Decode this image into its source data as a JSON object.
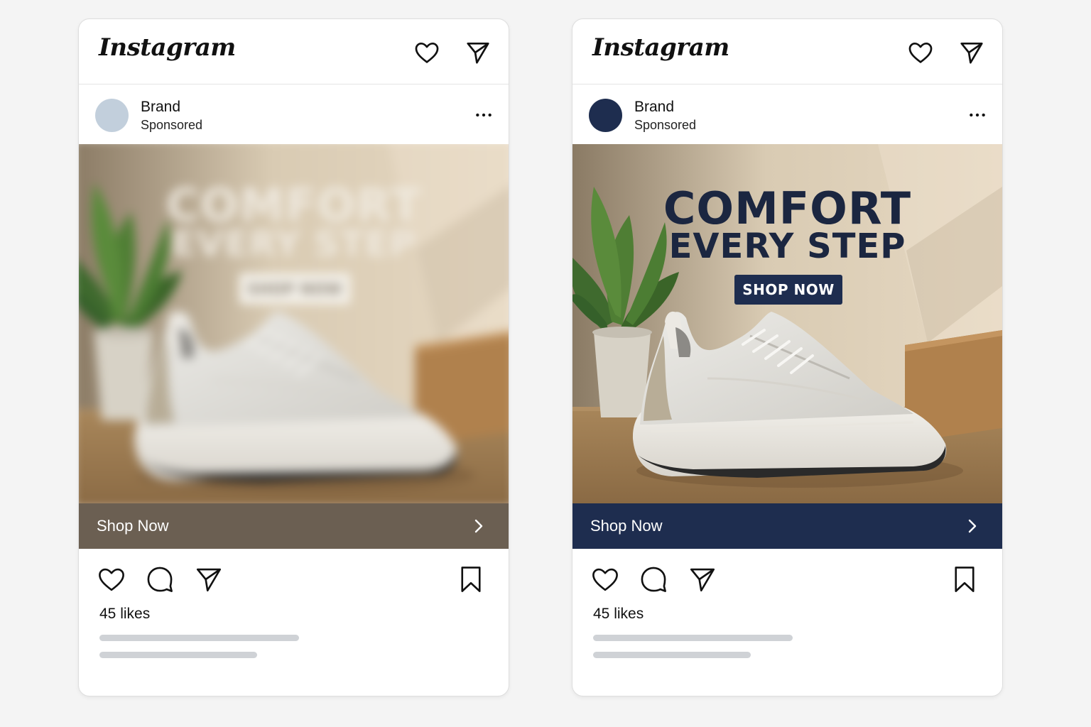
{
  "colors": {
    "page_bg": "#f4f4f4",
    "navy": "#1e2d4f",
    "cta_muted": "#6b5f52",
    "avatar_muted": "#c2cfdc",
    "caption_placeholder": "#cfd2d6"
  },
  "cards": [
    {
      "variant": "blurred",
      "header": {
        "logo": "Instagram",
        "heart_icon": "heart-outline-icon",
        "send_icon": "paper-plane-icon"
      },
      "post": {
        "brand": "Brand",
        "subtitle": "Sponsored",
        "more_icon": "ellipsis-icon"
      },
      "media": {
        "headline_1": "COMFORT",
        "headline_2": "EVERY STEP",
        "button": "SHOP NOW",
        "subject": "white knit sneaker"
      },
      "cta": {
        "label": "Shop Now",
        "icon": "chevron-right-icon"
      },
      "actions": {
        "like_icon": "heart-outline-icon",
        "comment_icon": "comment-bubble-icon",
        "share_icon": "paper-plane-icon",
        "save_icon": "bookmark-icon"
      },
      "likes": "45 likes"
    },
    {
      "variant": "sharp",
      "header": {
        "logo": "Instagram",
        "heart_icon": "heart-outline-icon",
        "send_icon": "paper-plane-icon"
      },
      "post": {
        "brand": "Brand",
        "subtitle": "Sponsored",
        "more_icon": "ellipsis-icon"
      },
      "media": {
        "headline_1": "COMFORT",
        "headline_2": "EVERY STEP",
        "button": "SHOP NOW",
        "subject": "white knit sneaker"
      },
      "cta": {
        "label": "Shop Now",
        "icon": "chevron-right-icon"
      },
      "actions": {
        "like_icon": "heart-outline-icon",
        "comment_icon": "comment-bubble-icon",
        "share_icon": "paper-plane-icon",
        "save_icon": "bookmark-icon"
      },
      "likes": "45 likes"
    }
  ]
}
